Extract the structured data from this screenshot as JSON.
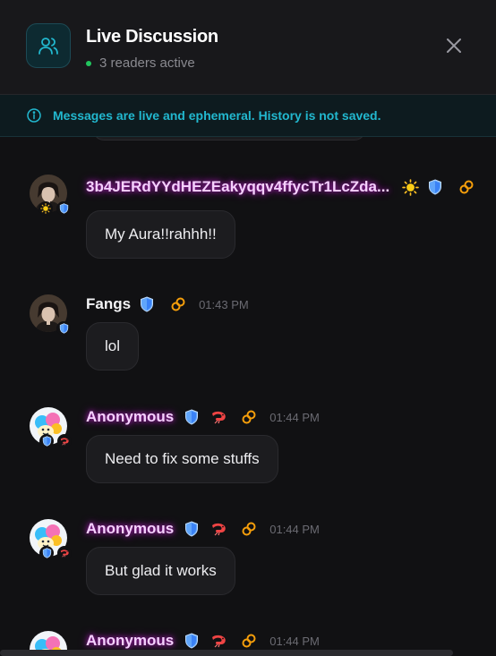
{
  "header": {
    "title": "Live Discussion",
    "status": "3 readers active"
  },
  "banner": {
    "text": "Messages are live and ephemeral. History is not saved."
  },
  "messages": [
    {
      "name": "3b4JERdYYdHEZEakyqqv4ffycTr1LcZda...",
      "text": "My Aura!!rahhh!!",
      "time": ""
    },
    {
      "name": "Fangs",
      "text": "lol",
      "time": "01:43 PM"
    },
    {
      "name": "Anonymous",
      "text": "Need to fix some stuffs",
      "time": "01:44 PM"
    },
    {
      "name": "Anonymous",
      "text": "But glad it works",
      "time": "01:44 PM"
    },
    {
      "name": "Anonymous",
      "text": "",
      "time": "01:44 PM"
    }
  ],
  "colors": {
    "accent": "#22b8cf",
    "online": "#22c55e",
    "name_glow": "#a21caf"
  },
  "icons": {
    "header": "users-icon",
    "close": "close-icon",
    "info": "info-icon",
    "shield": "shield-icon",
    "sun": "sun-icon",
    "link": "link-icon",
    "shrimp": "shrimp-icon"
  }
}
